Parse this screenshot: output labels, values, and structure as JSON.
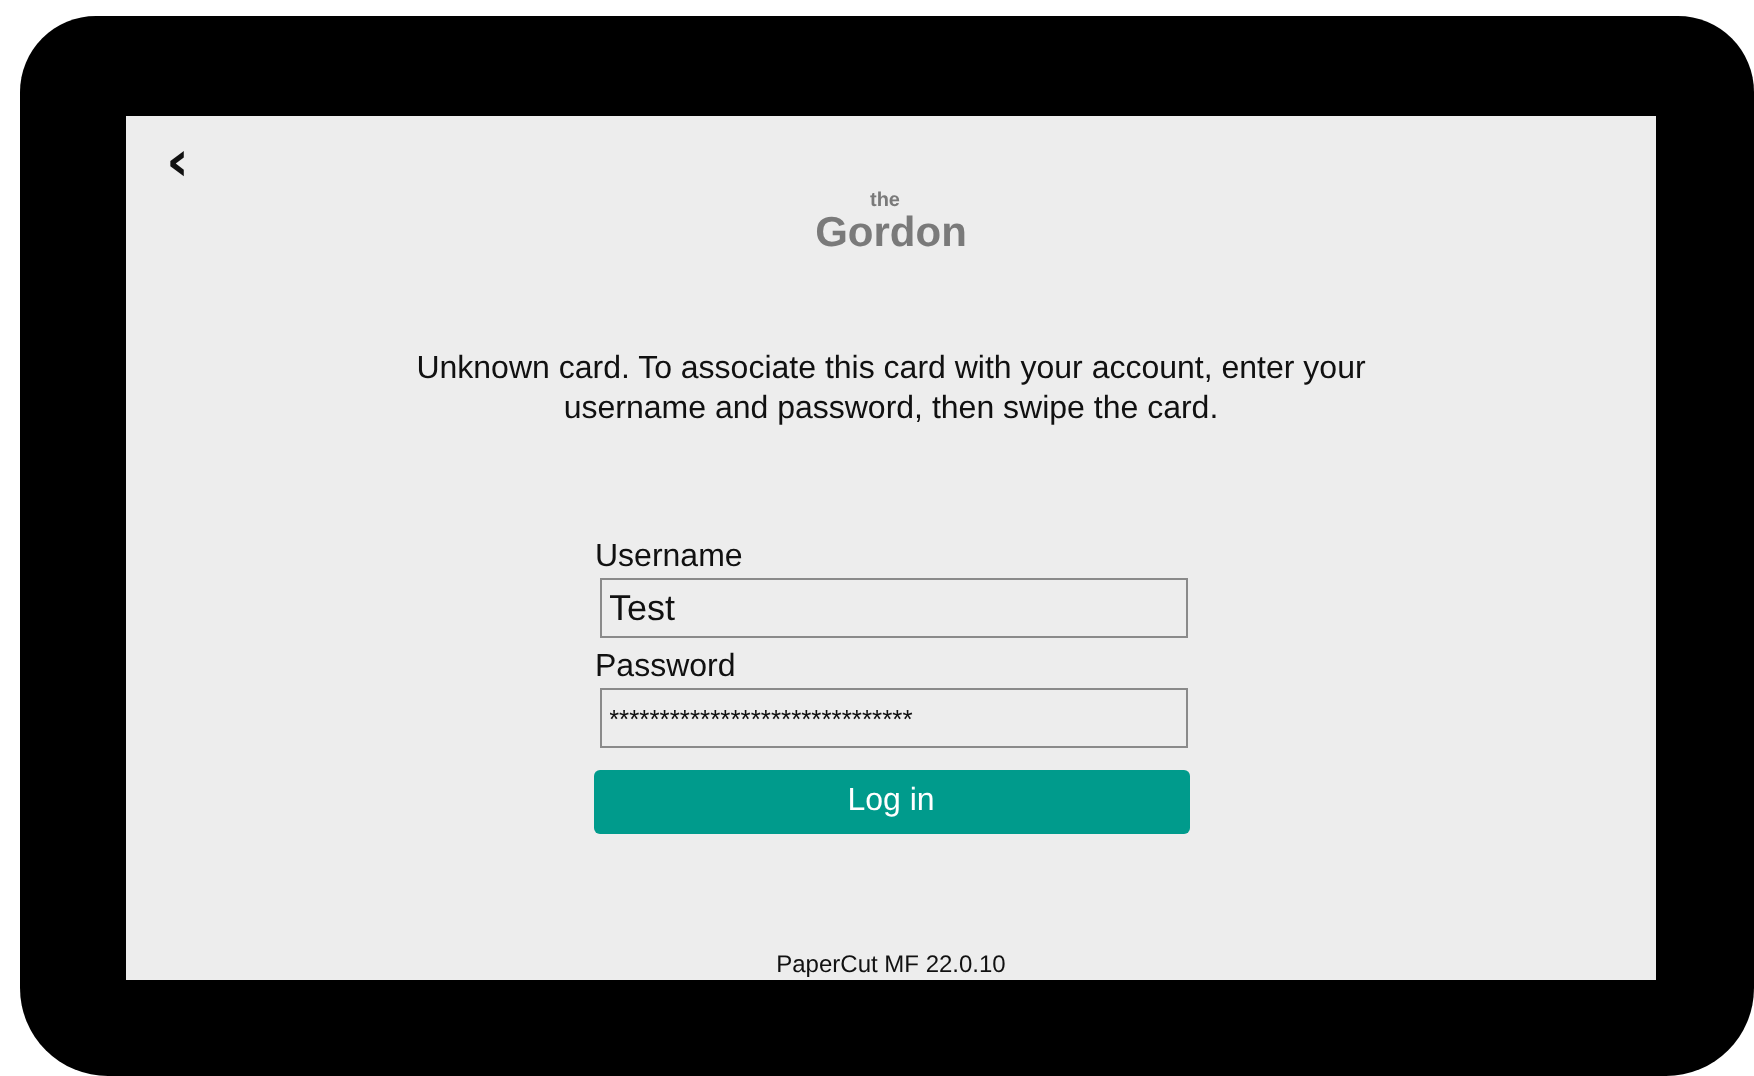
{
  "back_button": {
    "icon": "‹"
  },
  "logo": {
    "small": "the",
    "main": "Gordon"
  },
  "message": "Unknown card. To associate this card with your account, enter your username and password, then swipe the card.",
  "fields": [
    {
      "label": "Username",
      "value": "Test",
      "kind": "text"
    },
    {
      "label": "Password",
      "value": "******************************",
      "kind": "password"
    }
  ],
  "login_button": "Log in",
  "footer": "PaperCut MF 22.0.10"
}
